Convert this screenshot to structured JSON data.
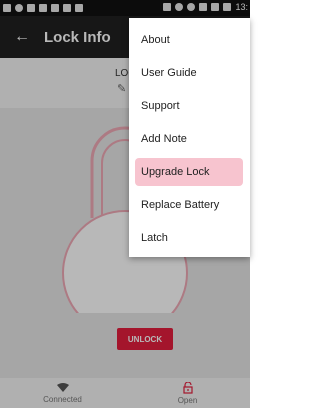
{
  "status_bar": {
    "time": "13:"
  },
  "app_bar": {
    "title": "Lock Info"
  },
  "lock": {
    "name_partial": "LOC"
  },
  "actions": {
    "unlock_label": "UNLOCK"
  },
  "bottom_nav": [
    {
      "label": "Connected",
      "icon": "wifi-icon"
    },
    {
      "label": "Open",
      "icon": "open-lock-icon"
    }
  ],
  "menu": {
    "items": [
      {
        "label": "About"
      },
      {
        "label": "User Guide"
      },
      {
        "label": "Support"
      },
      {
        "label": "Add Note"
      },
      {
        "label": "Upgrade Lock",
        "highlighted": true
      },
      {
        "label": "Replace Battery"
      },
      {
        "label": "Latch"
      }
    ]
  },
  "colors": {
    "accent": "#e31e3d",
    "highlight": "#f7c4cf",
    "appbar": "#212121",
    "lock_outline": "#f0a9b6"
  }
}
